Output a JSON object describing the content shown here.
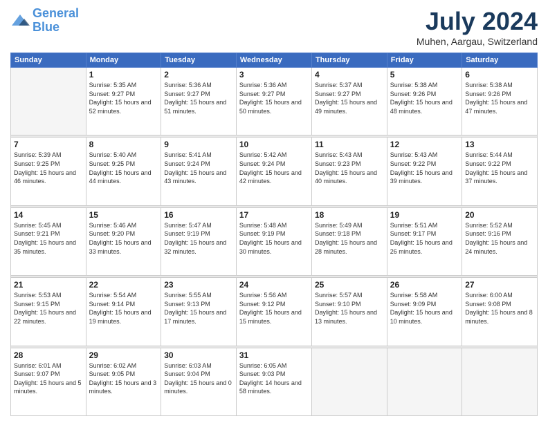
{
  "header": {
    "logo_line1": "General",
    "logo_line2": "Blue",
    "month": "July 2024",
    "location": "Muhen, Aargau, Switzerland"
  },
  "weekdays": [
    "Sunday",
    "Monday",
    "Tuesday",
    "Wednesday",
    "Thursday",
    "Friday",
    "Saturday"
  ],
  "weeks": [
    [
      {
        "day": "",
        "sunrise": "",
        "sunset": "",
        "daylight": ""
      },
      {
        "day": "1",
        "sunrise": "Sunrise: 5:35 AM",
        "sunset": "Sunset: 9:27 PM",
        "daylight": "Daylight: 15 hours and 52 minutes."
      },
      {
        "day": "2",
        "sunrise": "Sunrise: 5:36 AM",
        "sunset": "Sunset: 9:27 PM",
        "daylight": "Daylight: 15 hours and 51 minutes."
      },
      {
        "day": "3",
        "sunrise": "Sunrise: 5:36 AM",
        "sunset": "Sunset: 9:27 PM",
        "daylight": "Daylight: 15 hours and 50 minutes."
      },
      {
        "day": "4",
        "sunrise": "Sunrise: 5:37 AM",
        "sunset": "Sunset: 9:27 PM",
        "daylight": "Daylight: 15 hours and 49 minutes."
      },
      {
        "day": "5",
        "sunrise": "Sunrise: 5:38 AM",
        "sunset": "Sunset: 9:26 PM",
        "daylight": "Daylight: 15 hours and 48 minutes."
      },
      {
        "day": "6",
        "sunrise": "Sunrise: 5:38 AM",
        "sunset": "Sunset: 9:26 PM",
        "daylight": "Daylight: 15 hours and 47 minutes."
      }
    ],
    [
      {
        "day": "7",
        "sunrise": "Sunrise: 5:39 AM",
        "sunset": "Sunset: 9:25 PM",
        "daylight": "Daylight: 15 hours and 46 minutes."
      },
      {
        "day": "8",
        "sunrise": "Sunrise: 5:40 AM",
        "sunset": "Sunset: 9:25 PM",
        "daylight": "Daylight: 15 hours and 44 minutes."
      },
      {
        "day": "9",
        "sunrise": "Sunrise: 5:41 AM",
        "sunset": "Sunset: 9:24 PM",
        "daylight": "Daylight: 15 hours and 43 minutes."
      },
      {
        "day": "10",
        "sunrise": "Sunrise: 5:42 AM",
        "sunset": "Sunset: 9:24 PM",
        "daylight": "Daylight: 15 hours and 42 minutes."
      },
      {
        "day": "11",
        "sunrise": "Sunrise: 5:43 AM",
        "sunset": "Sunset: 9:23 PM",
        "daylight": "Daylight: 15 hours and 40 minutes."
      },
      {
        "day": "12",
        "sunrise": "Sunrise: 5:43 AM",
        "sunset": "Sunset: 9:22 PM",
        "daylight": "Daylight: 15 hours and 39 minutes."
      },
      {
        "day": "13",
        "sunrise": "Sunrise: 5:44 AM",
        "sunset": "Sunset: 9:22 PM",
        "daylight": "Daylight: 15 hours and 37 minutes."
      }
    ],
    [
      {
        "day": "14",
        "sunrise": "Sunrise: 5:45 AM",
        "sunset": "Sunset: 9:21 PM",
        "daylight": "Daylight: 15 hours and 35 minutes."
      },
      {
        "day": "15",
        "sunrise": "Sunrise: 5:46 AM",
        "sunset": "Sunset: 9:20 PM",
        "daylight": "Daylight: 15 hours and 33 minutes."
      },
      {
        "day": "16",
        "sunrise": "Sunrise: 5:47 AM",
        "sunset": "Sunset: 9:19 PM",
        "daylight": "Daylight: 15 hours and 32 minutes."
      },
      {
        "day": "17",
        "sunrise": "Sunrise: 5:48 AM",
        "sunset": "Sunset: 9:19 PM",
        "daylight": "Daylight: 15 hours and 30 minutes."
      },
      {
        "day": "18",
        "sunrise": "Sunrise: 5:49 AM",
        "sunset": "Sunset: 9:18 PM",
        "daylight": "Daylight: 15 hours and 28 minutes."
      },
      {
        "day": "19",
        "sunrise": "Sunrise: 5:51 AM",
        "sunset": "Sunset: 9:17 PM",
        "daylight": "Daylight: 15 hours and 26 minutes."
      },
      {
        "day": "20",
        "sunrise": "Sunrise: 5:52 AM",
        "sunset": "Sunset: 9:16 PM",
        "daylight": "Daylight: 15 hours and 24 minutes."
      }
    ],
    [
      {
        "day": "21",
        "sunrise": "Sunrise: 5:53 AM",
        "sunset": "Sunset: 9:15 PM",
        "daylight": "Daylight: 15 hours and 22 minutes."
      },
      {
        "day": "22",
        "sunrise": "Sunrise: 5:54 AM",
        "sunset": "Sunset: 9:14 PM",
        "daylight": "Daylight: 15 hours and 19 minutes."
      },
      {
        "day": "23",
        "sunrise": "Sunrise: 5:55 AM",
        "sunset": "Sunset: 9:13 PM",
        "daylight": "Daylight: 15 hours and 17 minutes."
      },
      {
        "day": "24",
        "sunrise": "Sunrise: 5:56 AM",
        "sunset": "Sunset: 9:12 PM",
        "daylight": "Daylight: 15 hours and 15 minutes."
      },
      {
        "day": "25",
        "sunrise": "Sunrise: 5:57 AM",
        "sunset": "Sunset: 9:10 PM",
        "daylight": "Daylight: 15 hours and 13 minutes."
      },
      {
        "day": "26",
        "sunrise": "Sunrise: 5:58 AM",
        "sunset": "Sunset: 9:09 PM",
        "daylight": "Daylight: 15 hours and 10 minutes."
      },
      {
        "day": "27",
        "sunrise": "Sunrise: 6:00 AM",
        "sunset": "Sunset: 9:08 PM",
        "daylight": "Daylight: 15 hours and 8 minutes."
      }
    ],
    [
      {
        "day": "28",
        "sunrise": "Sunrise: 6:01 AM",
        "sunset": "Sunset: 9:07 PM",
        "daylight": "Daylight: 15 hours and 5 minutes."
      },
      {
        "day": "29",
        "sunrise": "Sunrise: 6:02 AM",
        "sunset": "Sunset: 9:05 PM",
        "daylight": "Daylight: 15 hours and 3 minutes."
      },
      {
        "day": "30",
        "sunrise": "Sunrise: 6:03 AM",
        "sunset": "Sunset: 9:04 PM",
        "daylight": "Daylight: 15 hours and 0 minutes."
      },
      {
        "day": "31",
        "sunrise": "Sunrise: 6:05 AM",
        "sunset": "Sunset: 9:03 PM",
        "daylight": "Daylight: 14 hours and 58 minutes."
      },
      {
        "day": "",
        "sunrise": "",
        "sunset": "",
        "daylight": ""
      },
      {
        "day": "",
        "sunrise": "",
        "sunset": "",
        "daylight": ""
      },
      {
        "day": "",
        "sunrise": "",
        "sunset": "",
        "daylight": ""
      }
    ]
  ]
}
